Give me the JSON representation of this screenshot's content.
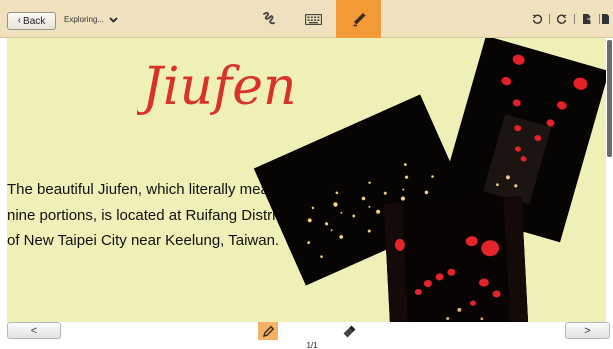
{
  "header": {
    "back_label": "Back",
    "notebook_label": "Exploring...",
    "tools": [
      {
        "icon": "handwriting-pen-icon",
        "active": false
      },
      {
        "icon": "keyboard-icon",
        "active": false
      },
      {
        "icon": "highlighter-icon",
        "active": true
      }
    ],
    "right_icons": [
      "undo-icon",
      "redo-icon",
      "export-icon",
      "share-icon"
    ]
  },
  "page": {
    "title": "Jiufen",
    "body_text": "The beautiful Jiufen, which literally means nine portions, is located at Ruifang District of New Taipei City near Keelung, Taiwan.",
    "background_color": "#eff0b7",
    "title_color": "#d8322b",
    "photos": [
      "jiufen-night-view-photo",
      "red-lanterns-street-photo",
      "lantern-alley-photo"
    ]
  },
  "footer": {
    "prev_label": "<",
    "next_label": ">",
    "page_indicator": "1/1",
    "modes": [
      {
        "icon": "pen-mode-icon",
        "active": true
      },
      {
        "icon": "eraser-icon",
        "active": false
      }
    ]
  },
  "colors": {
    "toolbar_bg": "#efe1bd",
    "active_tool": "#f39a36",
    "page_bg": "#eff0b7"
  }
}
